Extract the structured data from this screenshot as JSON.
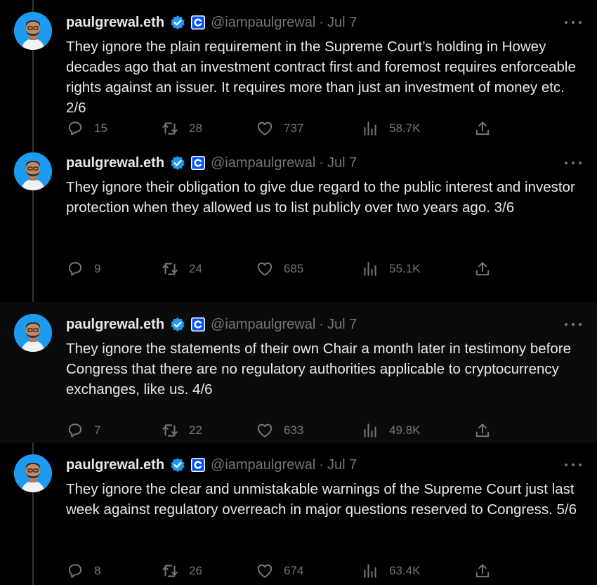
{
  "colors": {
    "accent": "#1d9bf0",
    "muted": "#71767b",
    "text": "#e7e9ea"
  },
  "tweets": [
    {
      "name": "paulgrewal.eth",
      "handle": "@iampaulgrewal",
      "sep": "·",
      "date": "Jul 7",
      "text": "They ignore the plain requirement in the Supreme Court’s holding in Howey decades ago that an investment contract first and foremost requires enforceable rights against an issuer. It requires more than just an investment of money etc. 2/6",
      "replies": "15",
      "retweets": "28",
      "likes": "737",
      "views": "58.7K"
    },
    {
      "name": "paulgrewal.eth",
      "handle": "@iampaulgrewal",
      "sep": "·",
      "date": "Jul 7",
      "text": "They ignore their obligation to give due regard to the public interest and investor protection when they allowed us to list publicly over two years ago. 3/6",
      "replies": "9",
      "retweets": "24",
      "likes": "685",
      "views": "55.1K"
    },
    {
      "name": "paulgrewal.eth",
      "handle": "@iampaulgrewal",
      "sep": "·",
      "date": "Jul 7",
      "text": "They ignore the statements of their own Chair a month later in testimony before Congress that there are no regulatory authorities applicable to cryptocurrency exchanges, like us. 4/6",
      "replies": "7",
      "retweets": "22",
      "likes": "633",
      "views": "49.8K"
    },
    {
      "name": "paulgrewal.eth",
      "handle": "@iampaulgrewal",
      "sep": "·",
      "date": "Jul 7",
      "text": "They ignore the clear and unmistakable warnings of the Supreme Court just last week against regulatory overreach in major questions reserved to Congress. 5/6",
      "replies": "8",
      "retweets": "26",
      "likes": "674",
      "views": "63.4K"
    }
  ]
}
